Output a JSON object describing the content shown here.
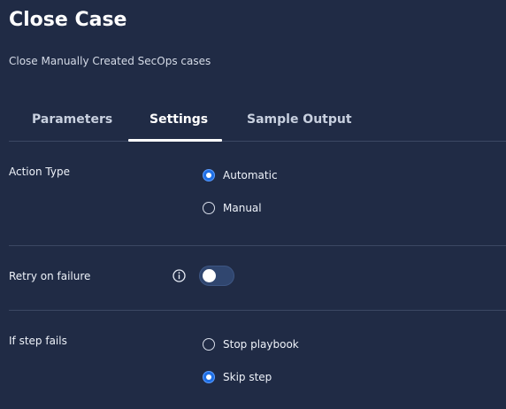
{
  "header": {
    "title": "Close Case",
    "subtitle": "Close Manually Created SecOps cases"
  },
  "tabs": [
    {
      "label": "Parameters",
      "active": false
    },
    {
      "label": "Settings",
      "active": true
    },
    {
      "label": "Sample Output",
      "active": false
    }
  ],
  "settings": {
    "action_type": {
      "label": "Action Type",
      "options": [
        {
          "label": "Automatic",
          "selected": true
        },
        {
          "label": "Manual",
          "selected": false
        }
      ]
    },
    "retry_on_failure": {
      "label": "Retry on failure",
      "icon": "info-icon",
      "enabled": false
    },
    "if_step_fails": {
      "label": "If step fails",
      "options": [
        {
          "label": "Stop playbook",
          "selected": false
        },
        {
          "label": "Skip step",
          "selected": true
        }
      ]
    }
  },
  "colors": {
    "background": "#202b45",
    "text": "#eef2f9",
    "accent": "#1f6fe5",
    "divider": "#3c4863"
  }
}
